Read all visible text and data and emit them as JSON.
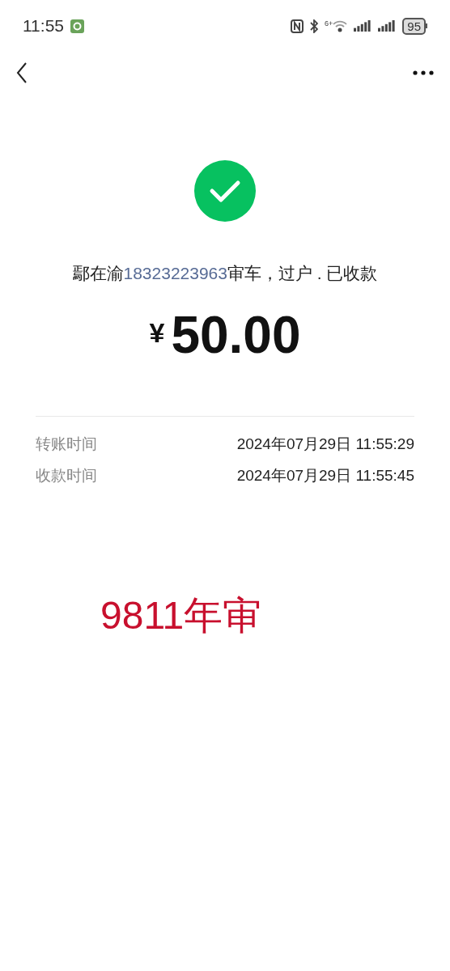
{
  "status_bar": {
    "time": "11:55",
    "wifi_badge": "6+",
    "battery": "95"
  },
  "receipt": {
    "note_before": "鄢在渝",
    "phone": "18323223963",
    "note_after": "审车，过户 . 已收款",
    "amount_symbol": "¥",
    "amount": "50.00"
  },
  "details": [
    {
      "label": "转账时间",
      "value": "2024年07月29日 11:55:29"
    },
    {
      "label": "收款时间",
      "value": "2024年07月29日 11:55:45"
    }
  ],
  "annotation": {
    "text": "9811年审",
    "color": "#c8102e"
  }
}
